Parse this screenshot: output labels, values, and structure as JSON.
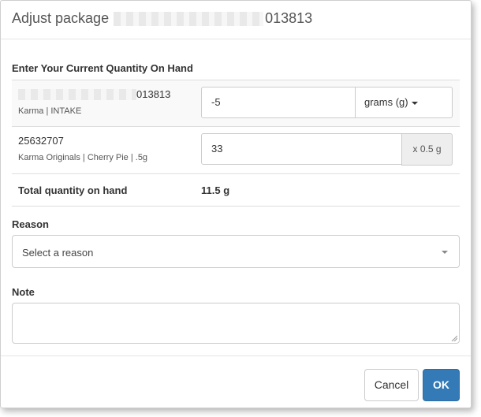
{
  "dialog": {
    "title_prefix": "Adjust package",
    "title_suffix": "013813"
  },
  "quantity_section": {
    "heading": "Enter Your Current Quantity On Hand",
    "rows": [
      {
        "id_suffix": "013813",
        "subtitle": "Karma | INTAKE",
        "quantity_value": "-5",
        "unit_label": "grams (g)"
      },
      {
        "id": "25632707",
        "subtitle": "Karma Originals | Cherry Pie | .5g",
        "quantity_value": "33",
        "unit_label": "x 0.5 g"
      }
    ],
    "total_label": "Total quantity on hand",
    "total_value": "11.5 g"
  },
  "reason": {
    "label": "Reason",
    "selected": "Select a reason"
  },
  "note": {
    "label": "Note",
    "value": ""
  },
  "footer": {
    "cancel_label": "Cancel",
    "ok_label": "OK"
  },
  "colors": {
    "primary": "#337ab7",
    "border": "#cccccc",
    "addon_bg": "#eeeeee",
    "striped_row": "#f9f9f9"
  },
  "icons": {
    "unit_dropdown": "caret-down-icon",
    "reason_select": "caret-down-icon",
    "textarea_resize": "resize-handle-icon"
  }
}
